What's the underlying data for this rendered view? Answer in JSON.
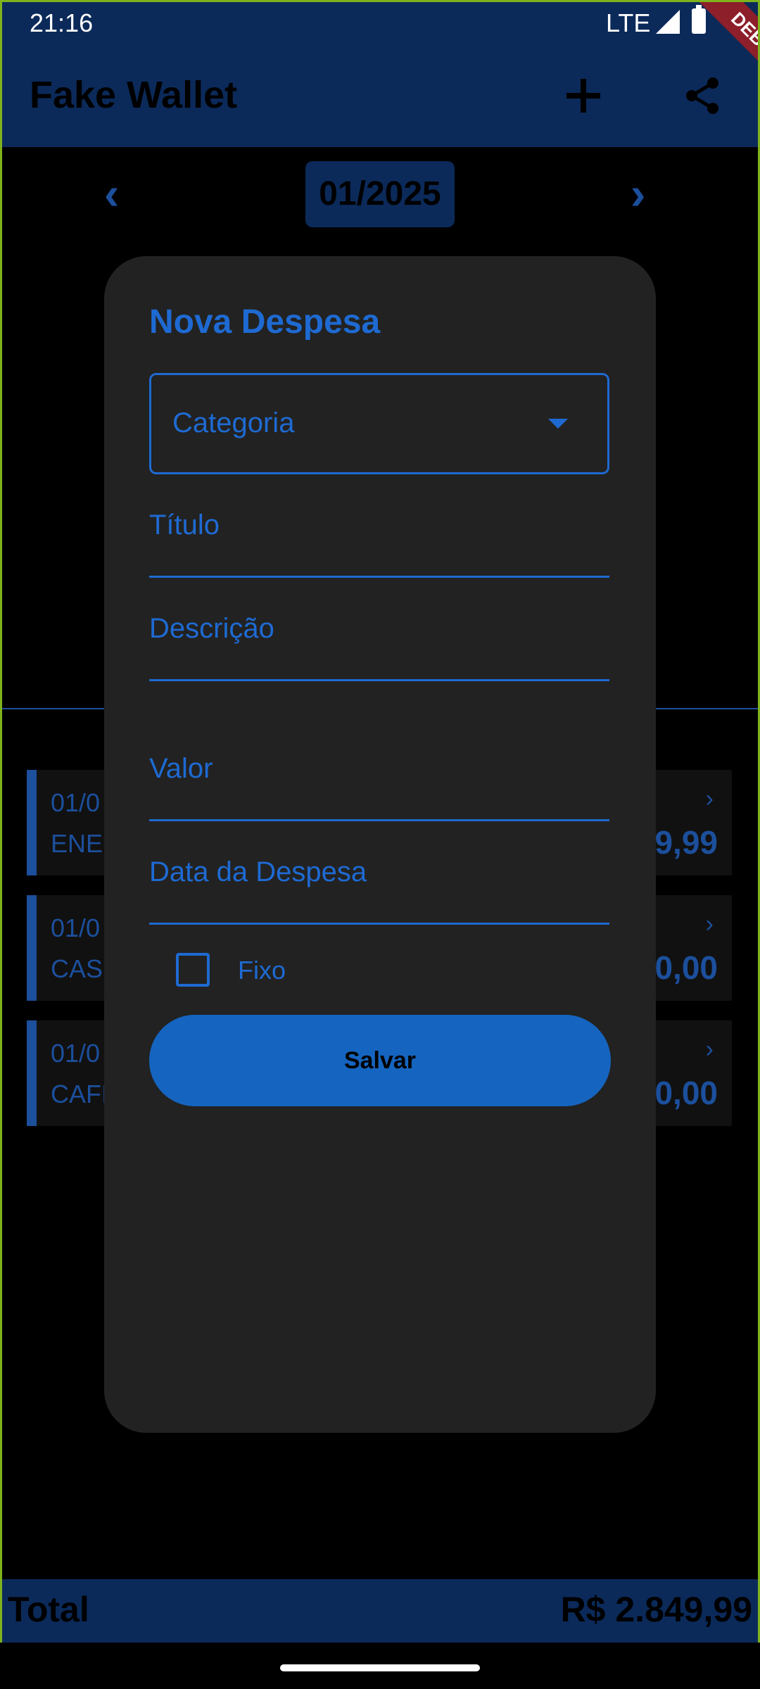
{
  "status": {
    "time": "21:16",
    "network": "LTE"
  },
  "debug_banner": "DEBUG",
  "app": {
    "title": "Fake Wallet"
  },
  "month": {
    "current": "01/2025"
  },
  "list": [
    {
      "date": "01/0",
      "name": "ENE",
      "amount": "9,99"
    },
    {
      "date": "01/0",
      "name": "CAS",
      "amount": "0,00"
    },
    {
      "date": "01/0",
      "name": "CAFI",
      "amount": "0,00"
    }
  ],
  "footer": {
    "label": "Total",
    "total": "R$ 2.849,99"
  },
  "dialog": {
    "title": "Nova Despesa",
    "category_label": "Categoria",
    "fields": {
      "titulo": "Título",
      "descricao": "Descrição",
      "valor": "Valor",
      "data": "Data da Despesa"
    },
    "checkbox_label": "Fixo",
    "checkbox_checked": false,
    "save_label": "Salvar"
  },
  "colors": {
    "accent": "#1e6ad2",
    "appbar": "#0b2a5a",
    "dialog_bg": "#222222",
    "debug_banner": "#8d1f2a"
  }
}
